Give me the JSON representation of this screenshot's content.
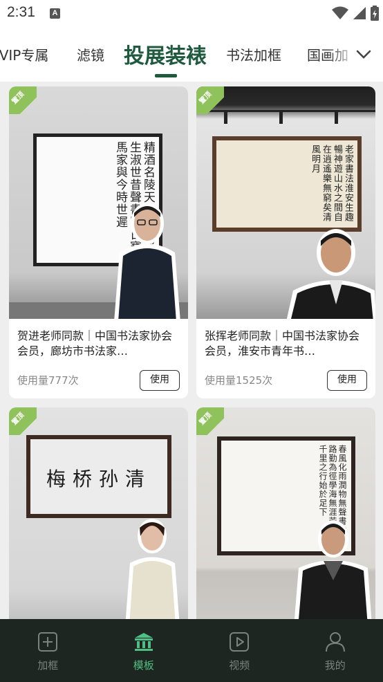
{
  "status_bar": {
    "time": "2:31",
    "notification_letter": "A"
  },
  "tabs": [
    {
      "label": "SVIP专属"
    },
    {
      "label": "滤镜"
    },
    {
      "label": "投展装裱",
      "active": true
    },
    {
      "label": "书法加框"
    },
    {
      "label": "国画加"
    }
  ],
  "accent_color": "#1f5a3f",
  "cards": [
    {
      "badge": "置顶",
      "title": "贺进老师同款｜中国书法家协会会员，廊坊市书法家…",
      "usage": "使用量777次",
      "button": "使用"
    },
    {
      "badge": "置顶",
      "title": "张挥老师同款｜中国书法家协会会员，淮安市青年书…",
      "usage": "使用量1525次",
      "button": "使用"
    },
    {
      "badge": "置顶",
      "title": "",
      "usage": "",
      "button": ""
    },
    {
      "badge": "置顶",
      "title": "",
      "usage": "",
      "button": ""
    }
  ],
  "bottom_nav": [
    {
      "label": "加框",
      "icon": "add-frame-icon"
    },
    {
      "label": "模板",
      "icon": "template-icon",
      "active": true
    },
    {
      "label": "视频",
      "icon": "video-play-icon"
    },
    {
      "label": "我的",
      "icon": "profile-icon"
    }
  ]
}
